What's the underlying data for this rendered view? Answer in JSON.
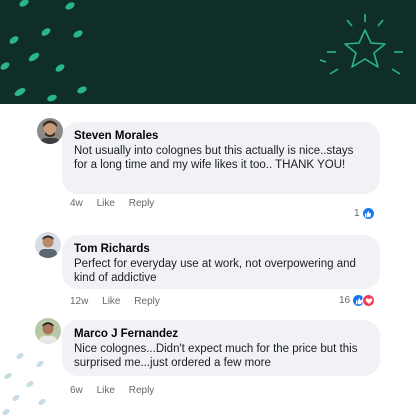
{
  "comments": [
    {
      "name": "Steven Morales",
      "text": "Not usually into colognes but this actually is nice..stays for a long time and my wife likes it too.. THANK YOU!",
      "time": "4w",
      "like_label": "Like",
      "reply_label": "Reply",
      "reaction_count": "1",
      "reactions": [
        "like-icon"
      ]
    },
    {
      "name": "Tom Richards",
      "text": "Perfect for everyday use at work, not overpowering and kind of addictive",
      "time": "12w",
      "like_label": "Like",
      "reply_label": "Reply",
      "reaction_count": "16",
      "reactions": [
        "like-icon",
        "love-icon"
      ]
    },
    {
      "name": "Marco J Fernandez",
      "text": "Nice colognes...Didn't expect much for the price but this surprised me...just ordered a few more",
      "time": "6w",
      "like_label": "Like",
      "reply_label": "Reply"
    }
  ],
  "colors": {
    "banner": "#0f2e27",
    "accent": "#2bb58a",
    "bubble": "#f0f2f5",
    "like": "#1877f2",
    "love": "#f33e58"
  }
}
